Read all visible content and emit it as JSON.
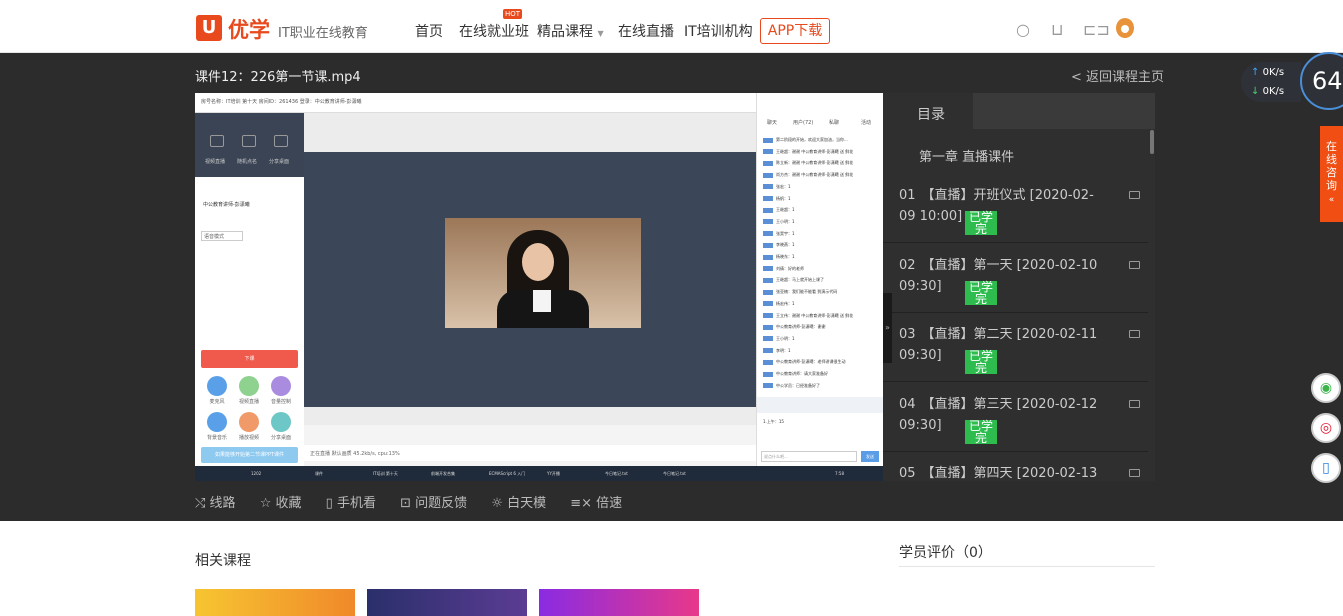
{
  "header": {
    "logo_mark": "U",
    "logo_name": "优学",
    "logo_sub": "IT职业在线教育",
    "nav": [
      "首页",
      "在线就业班",
      "精品课程",
      "在线直播",
      "IT培训机构"
    ],
    "hot_badge": "HOT",
    "app_button": "APP下载"
  },
  "course": {
    "title": "课件12：226第一节课.mp4",
    "back_link": "< 返回课程主页"
  },
  "player_screen": {
    "top_info": "房号名称：IT培训 第十天 房间ID：261436 登录：中公教育讲师-彭潇曦",
    "left_tabs": [
      "视频直播",
      "随机点名",
      "分享桌面"
    ],
    "user": "中公教育讲师-彭潇曦",
    "select": "语音模式",
    "red_button": "下课",
    "circle_labels": [
      "麦克风",
      "视频直播",
      "音量控制",
      "背景音乐",
      "播放视频",
      "分享桌面"
    ],
    "blue_button": "如果能够开始第二节课PPT课件",
    "status": "正在直播   默认画质   45.2kb/s, cpu:13%",
    "chat_tabs": [
      "聊天",
      "用户(72)",
      "私聊",
      "活动"
    ],
    "chat_lines": [
      "第二阶段的开始，欢迎大家加油，当你...",
      "王继超：谢谢 中公教育讲师-彭潇曦 送 鲜花",
      "陈立新：谢谢 中公教育讲师-彭潇曦 送 鲜花",
      "尚方杰：谢谢 中公教育讲师-彭潇曦 送 鲜花",
      "张宏：1",
      "杨帆：1",
      "王继超：1",
      "王小明：1",
      "张昊宇：1",
      "李晓燕：1",
      "杨晓东：1",
      "刘倩：好的老师",
      "王继超：马上就开始上课了",
      "张亚楠：我们能不能看 到演示代码",
      "杨宏伟：1",
      "王立伟：谢谢 中公教育讲师-彭潇曦 送 鲜花",
      "中公教育讲师-彭潇曦：谢谢",
      "王小明：1",
      "李明：1",
      "中公教育讲师-彭潇曦：老师讲课很生动",
      "中公教育讲师：请大家准备好",
      "中公学员：已经准备好了"
    ],
    "chat_input_value": "1.上午：15",
    "chat_placeholder": "说点什么吧...",
    "chat_send": "发送",
    "taskbar_items": [
      "1202",
      "课件",
      "IT培训 第十天",
      "前端开发合集",
      "ECMAScript 6 入门",
      "YY开播",
      "今日笔记.txt",
      "今日笔记.txt",
      "7:58"
    ]
  },
  "player_controls": [
    "线路",
    "收藏",
    "手机看",
    "问题反馈",
    "白天模",
    "倍速"
  ],
  "toc": {
    "tab_label": "目录",
    "chapter": "第一章 直播课件",
    "lessons": [
      {
        "num": "01",
        "title": "【直播】开班仪式 [2020-02-09 10:00]",
        "status": "已学完"
      },
      {
        "num": "02",
        "title": "【直播】第一天 [2020-02-10 09:30]",
        "status": "已学完"
      },
      {
        "num": "03",
        "title": "【直播】第二天 [2020-02-11 09:30]",
        "status": "已学完"
      },
      {
        "num": "04",
        "title": "【直播】第三天 [2020-02-12 09:30]",
        "status": "已学完"
      },
      {
        "num": "05",
        "title": "【直播】第四天 [2020-02-13",
        "status": ""
      }
    ]
  },
  "net_widget": {
    "up": "0K/s",
    "down": "0K/s",
    "percent": "64"
  },
  "consult": "在线咨询",
  "related_courses_title": "相关课程",
  "reviews_title": "学员评价（0）",
  "colors": {
    "brand": "#e8491d",
    "done": "#2ebc4f"
  }
}
